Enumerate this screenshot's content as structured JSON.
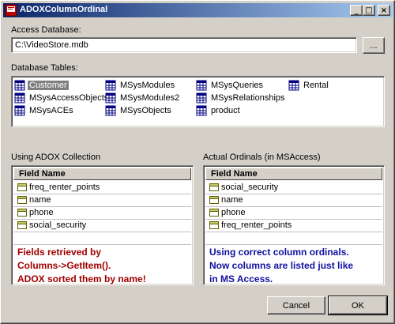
{
  "window": {
    "title": "ADOXColumnOrdinal"
  },
  "access_db": {
    "label": "Access Database:",
    "value": "C:\\VideoStore.mdb",
    "browse_label": "..."
  },
  "tables": {
    "label": "Database Tables:",
    "items": [
      {
        "label": "Customer",
        "selected": true
      },
      {
        "label": "MSysAccessObjects"
      },
      {
        "label": "MSysACEs"
      },
      {
        "label": "MSysModules"
      },
      {
        "label": "MSysModules2"
      },
      {
        "label": "MSysObjects"
      },
      {
        "label": "MSysQueries"
      },
      {
        "label": "MSysRelationships"
      },
      {
        "label": "product"
      },
      {
        "label": "Rental"
      }
    ]
  },
  "left_panel": {
    "label": "Using ADOX Collection",
    "header": "Field Name",
    "rows": [
      "freq_renter_points",
      "name",
      "phone",
      "social_security"
    ],
    "note_lines": [
      "Fields retrieved by",
      "Columns->GetItem().",
      "ADOX sorted them by name!"
    ],
    "note_color": "#a00000"
  },
  "right_panel": {
    "label": "Actual Ordinals (in MSAccess)",
    "header": "Field Name",
    "rows": [
      "social_security",
      "name",
      "phone",
      "freq_renter_points"
    ],
    "note_lines": [
      "Using correct column ordinals.",
      "Now columns are listed just like",
      "in MS Access."
    ],
    "note_color": "#1010a0"
  },
  "buttons": {
    "cancel": "Cancel",
    "ok": "OK"
  },
  "colors": {
    "titlebar_start": "#0a246a",
    "titlebar_end": "#a6caf0",
    "face": "#d4d0c8"
  }
}
